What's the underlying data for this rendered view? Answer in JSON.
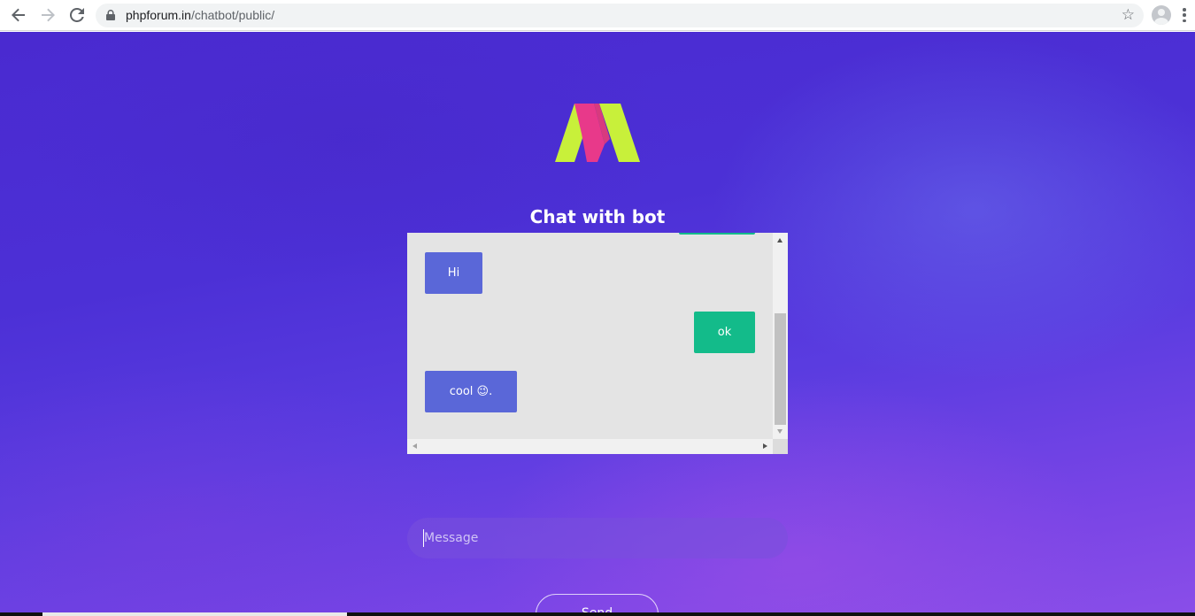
{
  "browser": {
    "url_domain": "phpforum.in",
    "url_path": "/chatbot/public/"
  },
  "page": {
    "title": "Chat with bot"
  },
  "chat": {
    "messages": [
      {
        "sender": "bot",
        "text": "Hi"
      },
      {
        "sender": "user",
        "text": "ok"
      },
      {
        "sender": "bot",
        "text": "cool 😉."
      }
    ]
  },
  "input": {
    "placeholder": "Message",
    "value": ""
  },
  "send_label": "Send",
  "colors": {
    "bot_bubble": "#5a67d8",
    "user_bubble": "#13bb8a",
    "logo_green": "#c8f03a",
    "logo_pink": "#e8398a"
  }
}
